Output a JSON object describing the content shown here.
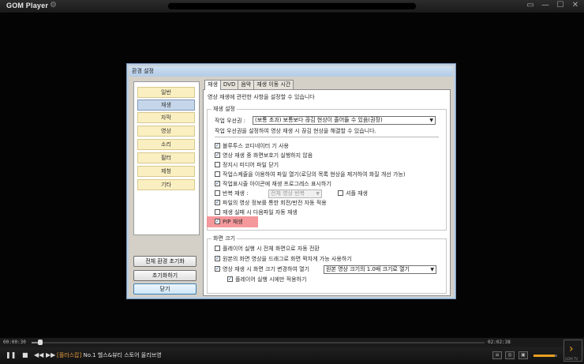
{
  "app": {
    "logo": "GOM Player",
    "window_controls": [
      "▭",
      "—",
      "☐",
      "✕"
    ]
  },
  "dialog": {
    "title": "환경 설정",
    "nav": [
      "일반",
      "재생",
      "자막",
      "영상",
      "소리",
      "필터",
      "제청",
      "기타"
    ],
    "active_nav": "재생",
    "reset_all_label": "전체 환경 초기화",
    "reset_label": "초기화하기",
    "close_label": "닫기",
    "tabs": [
      "재생",
      "DVD",
      "음악",
      "재생 이동 시간"
    ],
    "active_tab": "재생",
    "description": "영상 재생에 관련한 사항을 설정할 수 있습니다",
    "playback_group": {
      "title": "재생 설정",
      "priority_label": "작업 우선권 :",
      "priority_value": "(보통 초과) 보통보다 끊김 현상이 줄어들 수 있음(권장)",
      "priority_hint": "작업 우선권을 설정하여 영상 재생 시 끊김 현상을 해결할 수 있습니다.",
      "options": [
        {
          "label": "블루투스 코디네이터 기 사용",
          "checked": true
        },
        {
          "label": "영상 재생 중 화면보호기 실행하지 않음",
          "checked": true
        },
        {
          "label": "정지시 미디어 파일 닫기",
          "checked": false
        },
        {
          "label": "작업스케줄을 이용하여 파일 열기(로딩의 목록 현상을 제거하여 화질 개선 가능)",
          "checked": false
        },
        {
          "label": "작업표시줄 아이콘에 재생 프로그레스 표시하기",
          "checked": true
        },
        {
          "label": "반복 재생 :",
          "checked": false
        },
        {
          "label": "파일의 영상 정보를 통한 회전/반전 자동 적용",
          "checked": true
        },
        {
          "label": "재생 실패 시 다음파일 자동 재생",
          "checked": false
        },
        {
          "label": "PIP 재생",
          "checked": true
        }
      ],
      "repeat_select": "전체 영상 반복",
      "random_play_label": "셔플 재생"
    },
    "screen_group": {
      "title": "화면 크기",
      "options": [
        {
          "label": "플레이어 실행 시 전체 화면으로 자동 전환",
          "checked": false
        },
        {
          "label": "원본의 화면 영상을 드래그로 화면 꽉차게 가능 사용하기",
          "checked": true
        },
        {
          "label": "영상 재생 시 화면 크기 변경하여 열기",
          "checked": true
        },
        {
          "label": "플레이어 실행 시에만 적용하기",
          "checked": true
        }
      ],
      "size_select": "원본 영상 크기의 1.0배 크기로 열기"
    }
  },
  "player": {
    "time_elapsed": "00:00:30",
    "time_total": "02:02:38",
    "progress": 0.02,
    "volume": 0.9,
    "ticker_tag": "[플러스잡]",
    "ticker_text": "No.1 헬스&뷰티 스토어 올리브영",
    "side_label": "GOM TV"
  }
}
